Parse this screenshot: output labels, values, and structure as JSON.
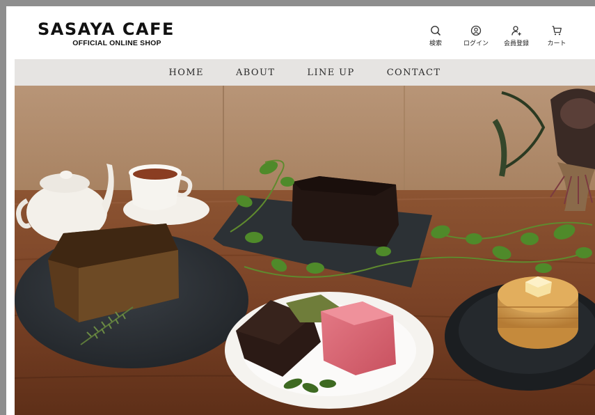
{
  "brand": {
    "title": "SASAYA CAFE",
    "subtitle": "OFFICIAL ONLINE SHOP"
  },
  "header_utils": [
    {
      "label": "検索",
      "icon": "search-icon"
    },
    {
      "label": "ログイン",
      "icon": "user-circle-icon"
    },
    {
      "label": "会員登録",
      "icon": "add-user-icon"
    },
    {
      "label": "カート",
      "icon": "cart-icon"
    }
  ],
  "nav": {
    "items": [
      {
        "label": "HOME"
      },
      {
        "label": "ABOUT"
      },
      {
        "label": "LINE UP"
      },
      {
        "label": "CONTACT"
      }
    ]
  },
  "hero": {
    "image": "cafe-cakes-photo"
  },
  "colors": {
    "nav_background": "#e6e4e2",
    "text": "#111111",
    "frame": "#8e8e8e"
  }
}
